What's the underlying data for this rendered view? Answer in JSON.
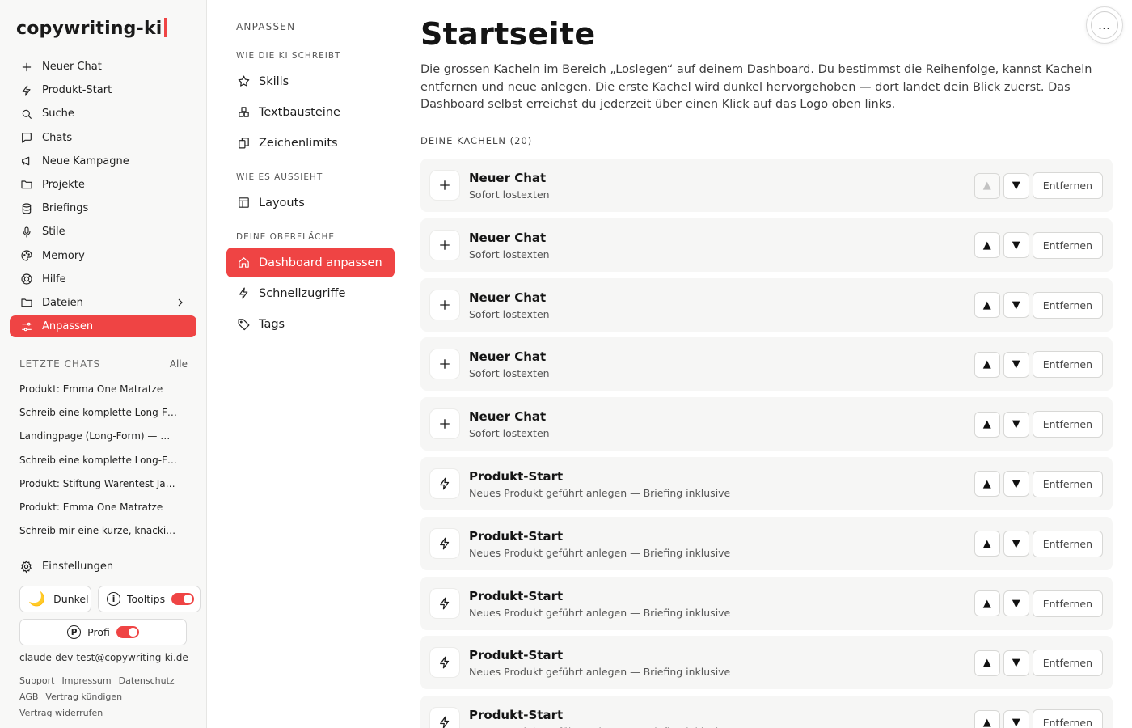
{
  "app": {
    "logo": "copywriting-ki",
    "accent_color": "#ef4444"
  },
  "sidebar": {
    "items": [
      {
        "label": "Neuer Chat",
        "icon": "plus-icon"
      },
      {
        "label": "Produkt-Start",
        "icon": "bolt-icon"
      },
      {
        "label": "Suche",
        "icon": "search-icon"
      },
      {
        "label": "Chats",
        "icon": "chat-bubble-icon"
      },
      {
        "label": "Neue Kampagne",
        "icon": "megaphone-icon"
      },
      {
        "label": "Projekte",
        "icon": "folder-icon"
      },
      {
        "label": "Briefings",
        "icon": "database-icon"
      },
      {
        "label": "Stile",
        "icon": "microphone-icon"
      },
      {
        "label": "Memory",
        "icon": "palette-icon"
      },
      {
        "label": "Hilfe",
        "icon": "lifebuoy-icon"
      },
      {
        "label": "Dateien",
        "icon": "folder-icon"
      },
      {
        "label": "Anpassen",
        "icon": "sliders-icon"
      }
    ],
    "recent_label": "LETZTE CHATS",
    "recent_all": "Alle",
    "recent": [
      "Produkt: Emma One Matratze",
      "Schreib eine komplette Long-F…",
      "Landingpage (Long-Form) — …",
      "Schreib eine komplette Long-F…",
      "Produkt: Stiftung Warentest Ja…",
      "Produkt: Emma One Matratze",
      "Schreib mir eine kurze, knacki…"
    ],
    "settings_label": "Einstellungen",
    "dark_label": "Dunkel",
    "tooltips_label": "Tooltips",
    "profi_label": "Profi",
    "profi_badge": "P",
    "tooltips_badge": "i",
    "email": "claude-dev-test@copywriting-ki.de",
    "footer_links": [
      "Support",
      "Impressum",
      "Datenschutz",
      "AGB",
      "Vertrag kündigen",
      "Vertrag widerrufen"
    ]
  },
  "panel": {
    "heading": "ANPASSEN",
    "sections": {
      "write": "WIE DIE KI SCHREIBT",
      "look": "WIE ES AUSSIEHT",
      "surface": "DEINE OBERFLÄCHE"
    },
    "items": {
      "skills": "Skills",
      "textbausteine": "Textbausteine",
      "zeichenlimits": "Zeichenlimits",
      "layouts": "Layouts",
      "dashboard": "Dashboard anpassen",
      "schnellzugriffe": "Schnellzugriffe",
      "tags": "Tags"
    }
  },
  "main": {
    "title": "Startseite",
    "description": "Die grossen Kacheln im Bereich „Loslegen“ auf deinem Dashboard. Du bestimmst die Reihenfolge, kannst Kacheln entfernen und neue anlegen. Die erste Kachel wird dunkel hervorgehoben — dort landet dein Blick zuerst. Das Dashboard selbst erreichst du jederzeit über einen Klick auf das Logo oben links.",
    "tiles_count_label": "DEINE KACHELN (20)",
    "up_symbol": "▲",
    "down_symbol": "▼",
    "remove_label": "Entfernen",
    "more_label": "…",
    "tiles": [
      {
        "title": "Neuer Chat",
        "subtitle": "Sofort lostexten",
        "icon": "plus-icon"
      },
      {
        "title": "Neuer Chat",
        "subtitle": "Sofort lostexten",
        "icon": "plus-icon"
      },
      {
        "title": "Neuer Chat",
        "subtitle": "Sofort lostexten",
        "icon": "plus-icon"
      },
      {
        "title": "Neuer Chat",
        "subtitle": "Sofort lostexten",
        "icon": "plus-icon"
      },
      {
        "title": "Neuer Chat",
        "subtitle": "Sofort lostexten",
        "icon": "plus-icon"
      },
      {
        "title": "Produkt-Start",
        "subtitle": "Neues Produkt geführt anlegen — Briefing inklusive",
        "icon": "bolt-icon"
      },
      {
        "title": "Produkt-Start",
        "subtitle": "Neues Produkt geführt anlegen — Briefing inklusive",
        "icon": "bolt-icon"
      },
      {
        "title": "Produkt-Start",
        "subtitle": "Neues Produkt geführt anlegen — Briefing inklusive",
        "icon": "bolt-icon"
      },
      {
        "title": "Produkt-Start",
        "subtitle": "Neues Produkt geführt anlegen — Briefing inklusive",
        "icon": "bolt-icon"
      },
      {
        "title": "Produkt-Start",
        "subtitle": "Neues Produkt geführt anlegen — Briefing inklusive",
        "icon": "bolt-icon"
      }
    ]
  }
}
